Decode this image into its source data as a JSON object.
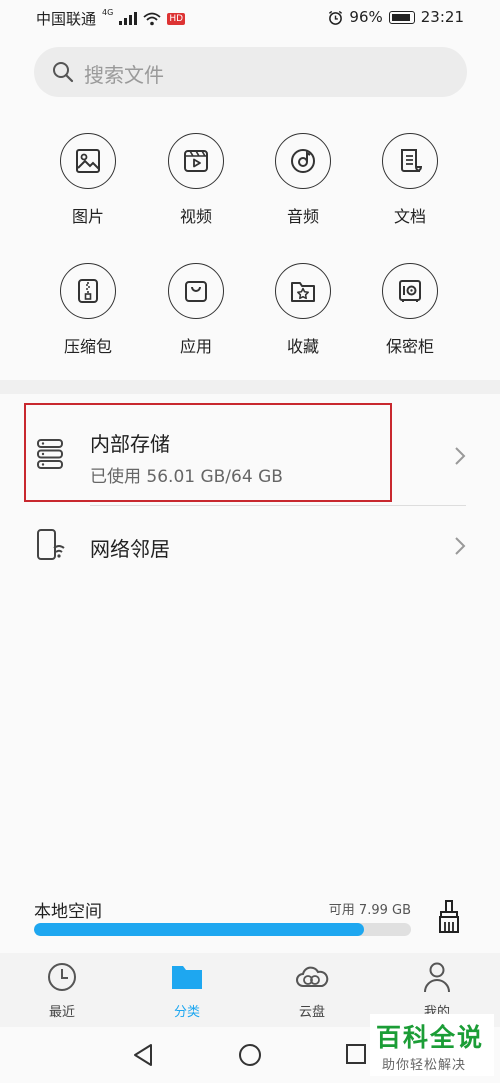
{
  "status_bar": {
    "carrier": "中国联通",
    "network": "4G",
    "hd": "HD",
    "battery": "96%",
    "time": "23:21"
  },
  "search": {
    "placeholder": "搜索文件"
  },
  "categories": [
    {
      "label": "图片",
      "icon": "image-icon"
    },
    {
      "label": "视频",
      "icon": "video-icon"
    },
    {
      "label": "音频",
      "icon": "audio-icon"
    },
    {
      "label": "文档",
      "icon": "document-icon"
    },
    {
      "label": "压缩包",
      "icon": "archive-icon"
    },
    {
      "label": "应用",
      "icon": "app-bag-icon"
    },
    {
      "label": "收藏",
      "icon": "favorites-folder-icon"
    },
    {
      "label": "保密柜",
      "icon": "safe-icon"
    }
  ],
  "storage": {
    "title": "内部存储",
    "usage": "已使用 56.01 GB/64 GB",
    "used_gb": 56.01,
    "total_gb": 64
  },
  "network": {
    "title": "网络邻居"
  },
  "local_space": {
    "title": "本地空间",
    "free": "可用 7.99 GB",
    "used_fraction": 0.875
  },
  "tabs": [
    {
      "label": "最近",
      "icon": "clock-icon",
      "active": false
    },
    {
      "label": "分类",
      "icon": "folder-icon",
      "active": true
    },
    {
      "label": "云盘",
      "icon": "cloud-icon",
      "active": false
    },
    {
      "label": "我的",
      "icon": "person-icon",
      "active": false
    }
  ],
  "watermark": {
    "title": "百科全说",
    "subtitle": "助你轻松解决"
  },
  "colors": {
    "accent": "#1ea7f0",
    "highlight_box": "#c8282e",
    "watermark": "#1b9d36"
  }
}
